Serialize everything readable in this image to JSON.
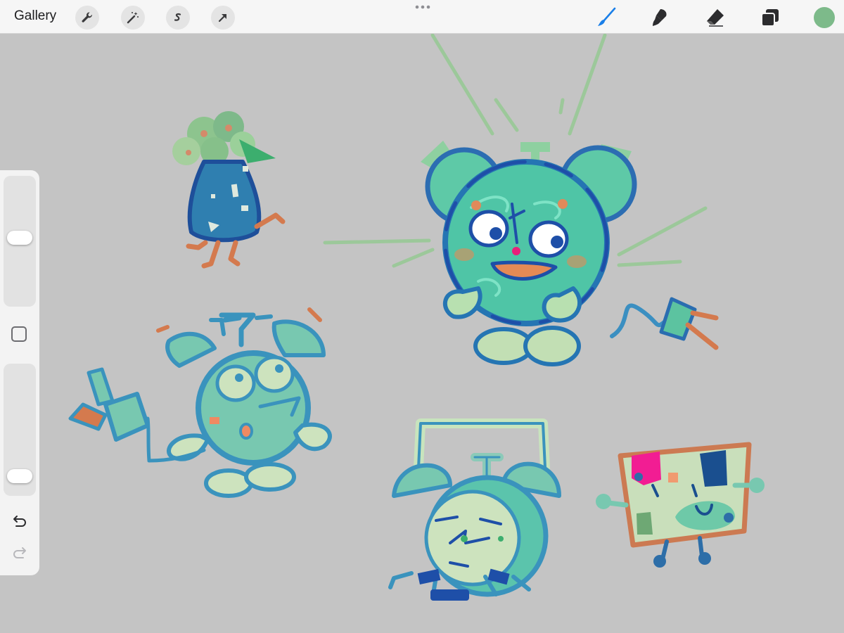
{
  "toolbar": {
    "gallery_label": "Gallery",
    "left_tools": [
      "wrench-icon",
      "magic-wand-icon",
      "selection-icon",
      "transform-arrow-icon"
    ],
    "right_tools": [
      "brush-icon",
      "smudge-icon",
      "eraser-icon",
      "layers-icon"
    ],
    "active_tool": "brush-icon",
    "active_color": "#7dba8a"
  },
  "sidebar": {
    "brush_size_level": 0.53,
    "opacity_level": 0.08,
    "undo_icon": "undo-icon",
    "redo_icon": "redo-icon"
  },
  "canvas": {
    "background_color": "#c4c4c4",
    "sketches": [
      "flower-vase-character",
      "happy-alarm-clock-character",
      "plug-sketch",
      "thinking-alarm-clock-character",
      "standing-alarm-clock-character",
      "picture-frame-character"
    ]
  }
}
